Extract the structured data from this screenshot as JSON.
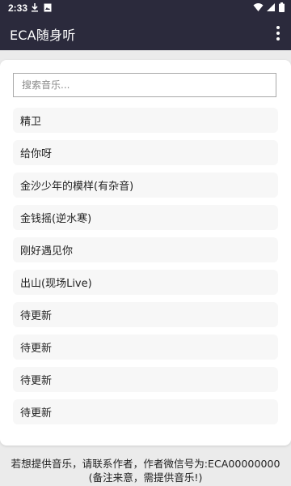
{
  "status_bar": {
    "time": "2:33"
  },
  "app_bar": {
    "title": "ECA随身听",
    "more_icon": "more-vert-icon"
  },
  "search": {
    "placeholder": "搜索音乐...",
    "value": ""
  },
  "songs": [
    "精卫",
    "给你呀",
    "金沙少年的模样(有杂音)",
    "金钱摇(逆水寒)",
    "刚好遇见你",
    "出山(现场Live)",
    "待更新",
    "待更新",
    "待更新",
    "待更新"
  ],
  "footer": {
    "line1": "若想提供音乐，请联系作者，作者微信号为:ECA00000000",
    "line2": "(备注来意，需提供音乐!)"
  }
}
